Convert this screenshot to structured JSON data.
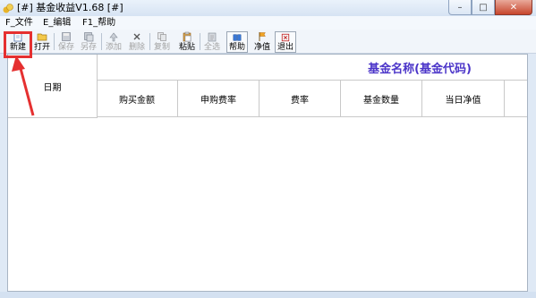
{
  "window": {
    "title": "[#] 基金收益V1.68 [#]",
    "min_glyph": "–",
    "max_glyph": "□",
    "close_glyph": "✕"
  },
  "menu": [
    "F_文件",
    "E_编辑",
    "F1_帮助"
  ],
  "toolbar": {
    "new": "新建",
    "open": "打开",
    "save": "保存",
    "save_as": "另存",
    "add": "添加",
    "delete": "删除",
    "copy": "复制",
    "paste": "粘贴",
    "select_all": "全选",
    "help": "帮助",
    "nav": "净值",
    "exit": "退出"
  },
  "table": {
    "date_header": "日期",
    "fund_header": "基金名称(基金代码)",
    "columns": [
      "购买金额",
      "申购费率",
      "费率",
      "基金数量",
      "当日净值"
    ]
  },
  "colors": {
    "fund_header": "#4b35c9",
    "highlight": "#e53030"
  }
}
